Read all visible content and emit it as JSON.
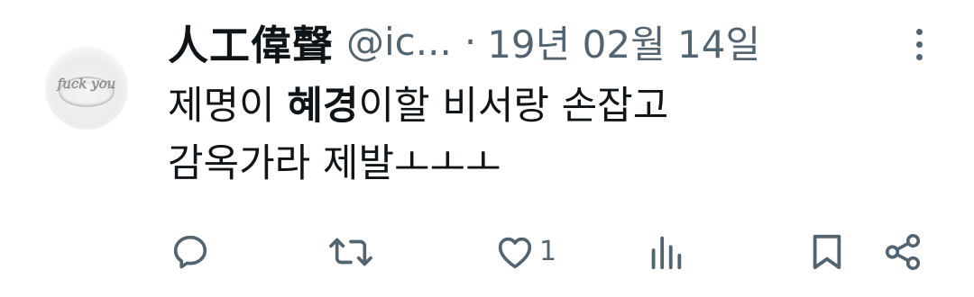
{
  "tweet": {
    "author": {
      "display_name": "人工偉聲",
      "handle": "@ic...",
      "avatar_icon": "ring-avatar-icon",
      "avatar_text": "fuck you"
    },
    "separator": "·",
    "date": "19년 02월 14일",
    "more_icon": "more-vertical-icon",
    "body": {
      "line1_pre": "제명이 ",
      "line1_bold": "혜경",
      "line1_post": "이할 비서랑 손잡고",
      "line2": "감옥가라 제발ㅗㅗㅗ"
    },
    "actions": {
      "reply": {
        "icon": "reply-icon",
        "count": ""
      },
      "retweet": {
        "icon": "retweet-icon",
        "count": ""
      },
      "like": {
        "icon": "heart-icon",
        "count": "1"
      },
      "views": {
        "icon": "views-icon",
        "count": ""
      },
      "bookmark": {
        "icon": "bookmark-icon"
      },
      "share": {
        "icon": "share-icon"
      }
    }
  },
  "colors": {
    "text_primary": "#0f1419",
    "text_secondary": "#536471",
    "background": "#ffffff"
  }
}
